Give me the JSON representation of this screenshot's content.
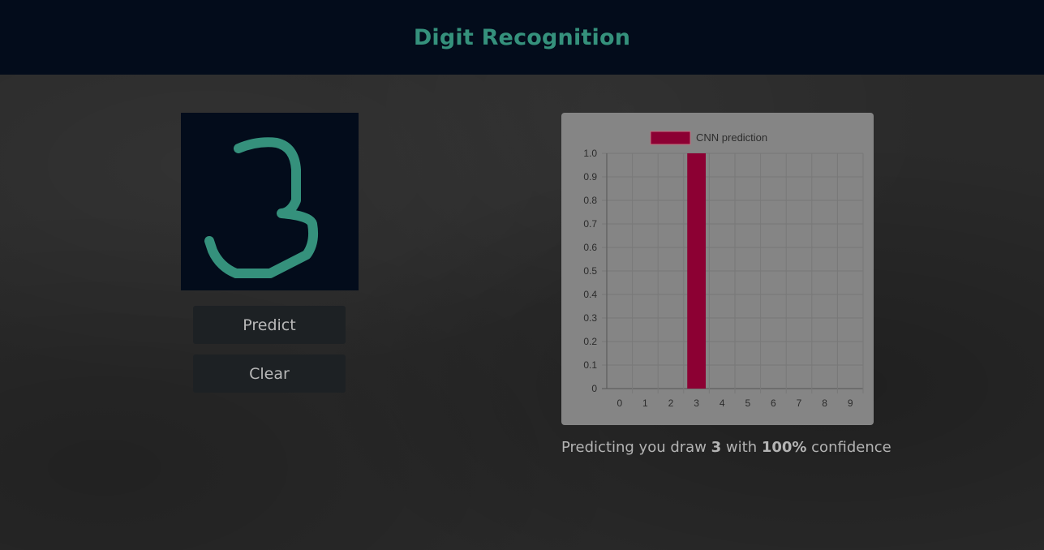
{
  "header": {
    "title": "Digit Recognition"
  },
  "drawing": {
    "stroke_color": "#35917c",
    "background": "#030c1b",
    "drawn_digit": "3"
  },
  "buttons": {
    "predict_label": "Predict",
    "clear_label": "Clear"
  },
  "result": {
    "prefix": "Predicting you draw ",
    "digit": "3",
    "middle": " with ",
    "confidence": "100%",
    "suffix": " confidence"
  },
  "chart_data": {
    "type": "bar",
    "categories": [
      "0",
      "1",
      "2",
      "3",
      "4",
      "5",
      "6",
      "7",
      "8",
      "9"
    ],
    "series": [
      {
        "name": "CNN prediction",
        "values": [
          0,
          0,
          0,
          1.0,
          0,
          0,
          0,
          0,
          0,
          0
        ],
        "color": "#8c0033"
      }
    ],
    "ylim": [
      0,
      1.0
    ],
    "yticks": [
      "0",
      "0.1",
      "0.2",
      "0.3",
      "0.4",
      "0.5",
      "0.6",
      "0.7",
      "0.8",
      "0.9",
      "1.0"
    ],
    "grid": true,
    "legend_position": "top"
  }
}
